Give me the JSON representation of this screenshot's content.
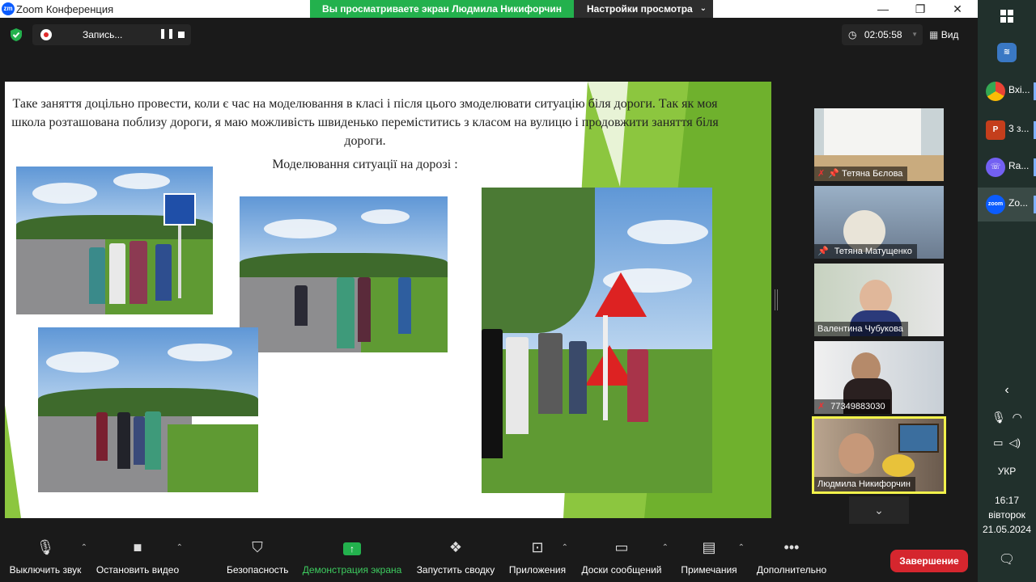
{
  "window": {
    "title": "Zoom Конференция",
    "share_banner": "Вы просматриваете экран Людмила Никифорчин",
    "view_settings": "Настройки просмотра",
    "minimize": "—",
    "restore": "❐",
    "close": "✕"
  },
  "topbar": {
    "record_label": "Запись...",
    "timer": "02:05:58",
    "view_label": "Вид"
  },
  "slide": {
    "text": "Таке заняття доцільно провести, коли є час на моделювання в класі і після цього змоделювати ситуацію біля дороги. Так як моя школа розташована поблизу дороги, я маю можливість швиденько переміститись з класом на вулицю і продовжити заняття біля дороги.",
    "subtitle": "Моделювання ситуації на дорозі :"
  },
  "participants": [
    {
      "name": "Тетяна Бєлова",
      "muted": true,
      "pinned": true
    },
    {
      "name": "Тетяна Матущенко",
      "muted": false,
      "pinned": true
    },
    {
      "name": "Валентина Чубукова",
      "muted": false,
      "pinned": false
    },
    {
      "name": "77349883030",
      "muted": true,
      "pinned": false
    },
    {
      "name": "Людмила Никифорчин",
      "muted": false,
      "pinned": false,
      "active": true
    }
  ],
  "toolbar": {
    "mute": "Выключить звук",
    "video": "Остановить видео",
    "security": "Безопасность",
    "share": "Демонстрация экрана",
    "summary": "Запустить сводку",
    "apps": "Приложения",
    "whiteboards": "Доски сообщений",
    "notes": "Примечания",
    "more": "Дополнительно",
    "end": "Завершение"
  },
  "taskbar": {
    "items": [
      {
        "label": "",
        "icon": "windows-start-icon"
      },
      {
        "label": "",
        "icon": "app-icon"
      },
      {
        "label": "Вхі...",
        "icon": "chrome-icon"
      },
      {
        "label": "3 з...",
        "icon": "powerpoint-icon"
      },
      {
        "label": "Ra...",
        "icon": "viber-icon"
      },
      {
        "label": "Zo...",
        "icon": "zoom-icon"
      }
    ],
    "language": "УКР",
    "time": "16:17",
    "day": "вівторок",
    "date": "21.05.2024"
  },
  "colors": {
    "share_green": "#23b14d",
    "end_red": "#d5262e",
    "active_tile": "#f2f24b",
    "slide_green": "#8cc63f"
  }
}
